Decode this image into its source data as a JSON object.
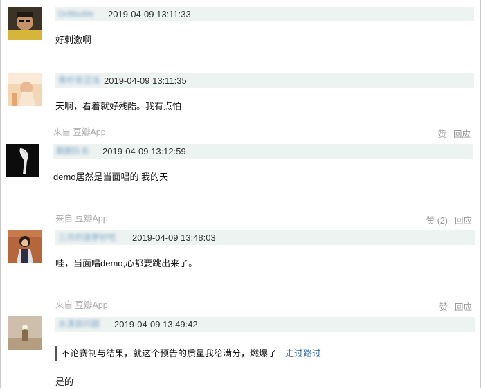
{
  "comments": [
    {
      "author": "Driftbottle",
      "time": "2019-04-09 13:11:33",
      "text": "好刺激啊"
    },
    {
      "author": "青柠苦涩浅",
      "time": "2019-04-09 13:11:35",
      "text": "天啊，看着就好残酷。我有点怕",
      "source": "来自 豆瓣App",
      "like": "赞",
      "reply": "回应"
    },
    {
      "author": "鹅鹅队长",
      "time": "2019-04-09 13:12:59",
      "text": "demo居然是当面唱的 我的天",
      "source": "来自 豆瓣App",
      "like": "赞 (2)",
      "reply": "回应"
    },
    {
      "author": "三月的菠萝好吃",
      "time": "2019-04-09 13:48:03",
      "text": "哇，当面唱demo,心都要跳出来了。",
      "source": "来自 豆瓣App",
      "like": "赞",
      "reply": "回应"
    },
    {
      "author": "水漾部问题",
      "time": "2019-04-09 13:49:42",
      "quote": "不论赛制与结果，就这个预告的质量我给满分，燃爆了",
      "quote_author": "走过路过",
      "text": "是的"
    }
  ]
}
